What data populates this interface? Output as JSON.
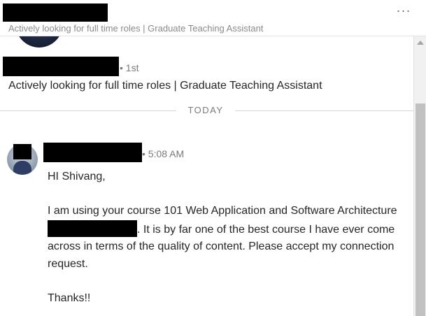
{
  "header": {
    "subtitle": "Actively looking for full time roles | Graduate Teaching Assistant",
    "more_label": "···"
  },
  "profile": {
    "degree": "• 1st",
    "headline": "Actively looking for full time roles | Graduate Teaching Assistant"
  },
  "divider": {
    "label": "TODAY"
  },
  "message": {
    "time": "• 5:08 AM",
    "greeting": "HI Shivang,",
    "line_before_redaction": "I am using your course 101 Web Application and Software Architecture",
    "line_after_redaction": ". It is by far one of the best course I have ever come across in terms of the quality of content. Please accept my connection request.",
    "closing": "Thanks!!"
  }
}
